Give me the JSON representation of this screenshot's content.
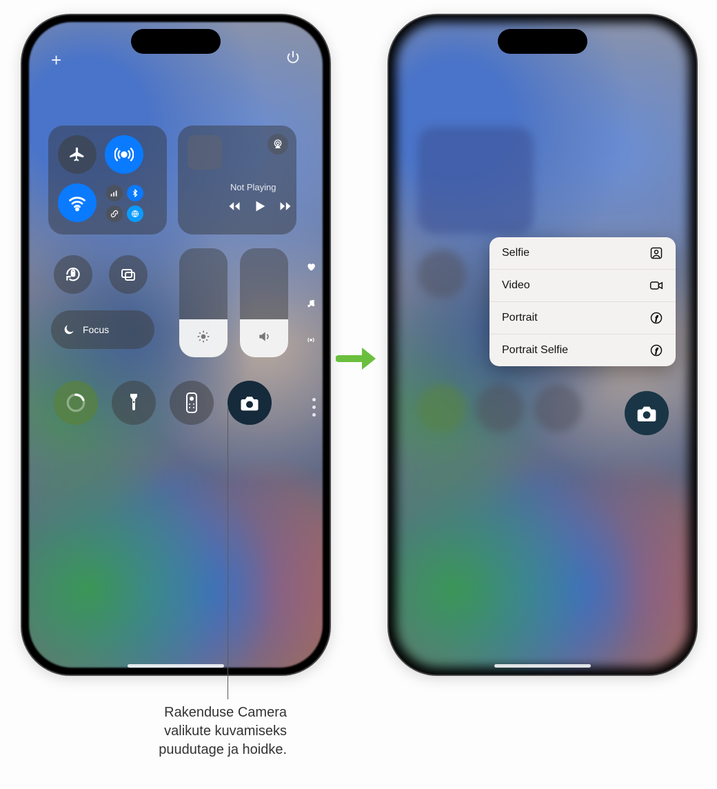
{
  "left_phone": {
    "top": {
      "plus_label": "+",
      "power_label": "⏻"
    },
    "connectivity": {
      "airplane": "airplane",
      "airdrop": "airdrop",
      "wifi": "wifi",
      "mini": {
        "cellular": "cellular",
        "bluetooth": "bluetooth",
        "link": "link",
        "hotspot": "hotspot"
      }
    },
    "media": {
      "status": "Not Playing",
      "airplay": "airplay",
      "prev": "⏮",
      "play": "▶",
      "next": "⏭"
    },
    "row2": {
      "orientation_lock": "orientation-lock",
      "screen_mirror": "screen-mirroring",
      "focus_label": "Focus",
      "focus_icon": "moon"
    },
    "sliders": {
      "brightness_pct": 35,
      "volume_pct": 35
    },
    "bottom_row": {
      "timer": "timer",
      "flashlight": "flashlight",
      "remote": "apple-tv-remote",
      "camera": "camera"
    },
    "side": {
      "heart": "♥",
      "music": "♫",
      "antenna": "((•))",
      "dots": "⋮"
    }
  },
  "right_phone": {
    "menu": [
      {
        "label": "Selfie",
        "icon": "person-square"
      },
      {
        "label": "Video",
        "icon": "video"
      },
      {
        "label": "Portrait",
        "icon": "aperture"
      },
      {
        "label": "Portrait Selfie",
        "icon": "aperture"
      }
    ],
    "camera_button": "camera"
  },
  "callout": {
    "line1": "Rakenduse Camera",
    "line2": "valikute kuvamiseks",
    "line3": "puudutage ja hoidke."
  }
}
